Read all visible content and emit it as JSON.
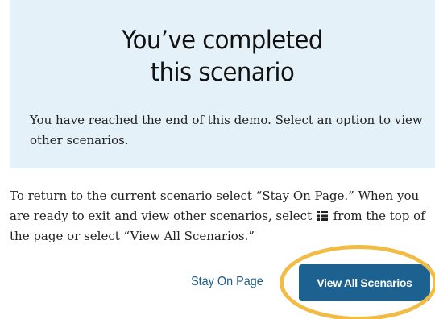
{
  "panel": {
    "heading_line1": "You’ve completed",
    "heading_line2": "this scenario",
    "text": "You have reached the end of this demo. Select an option to view other scenarios."
  },
  "instructions": {
    "line1": "To return to the current scenario select “Stay On Page.” When you",
    "line2_before_icon": "are ready to exit and view other scenarios, select",
    "line2_after_icon": "from the top of",
    "line3": "the page or select “View All Scenarios.”",
    "icon": "list-icon"
  },
  "actions": {
    "stay_label": "Stay On Page",
    "view_all_label": "View All Scenarios"
  },
  "colors": {
    "panel_background": "#e5f1f8",
    "primary_button": "#1c618f",
    "link": "#1c5e8a",
    "highlight": "#f2bb43"
  }
}
